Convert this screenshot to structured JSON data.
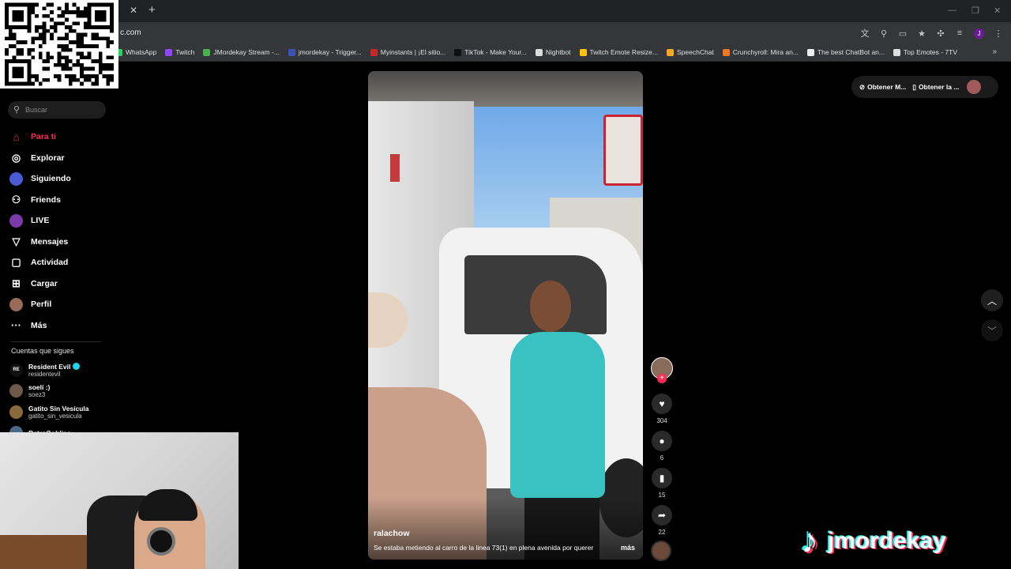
{
  "browser": {
    "url": "c.com",
    "tab_close": "✕",
    "tab_new": "+",
    "profile_initial": "J",
    "bookmarks": [
      {
        "label": "WhatsApp",
        "color": "#25d366"
      },
      {
        "label": "Twitch",
        "color": "#9146ff"
      },
      {
        "label": "JMordekay Stream -...",
        "color": "#4caf50"
      },
      {
        "label": "jmordekay - Trigger...",
        "color": "#3f51b5"
      },
      {
        "label": "Myinstants | ¡El sitio...",
        "color": "#c62828"
      },
      {
        "label": "TikTok - Make Your...",
        "color": "#111111"
      },
      {
        "label": "Nightbot",
        "color": "#dddddd"
      },
      {
        "label": "Twitch Emote Resize...",
        "color": "#ffc107"
      },
      {
        "label": "SpeechChat",
        "color": "#f9a825"
      },
      {
        "label": "Crunchyroll: Mira an...",
        "color": "#f47521"
      },
      {
        "label": "The best ChatBot an...",
        "color": "#eeeeee"
      },
      {
        "label": "Top Emotes - 7TV",
        "color": "#dddddd"
      }
    ]
  },
  "sidebar": {
    "search_placeholder": "Buscar",
    "nav": [
      {
        "label": "Para ti",
        "icon": "home-icon",
        "glyph": "⌂"
      },
      {
        "label": "Explorar",
        "icon": "compass-icon",
        "glyph": "◎"
      },
      {
        "label": "Siguiendo",
        "icon": "following-avatar",
        "glyph": ""
      },
      {
        "label": "Friends",
        "icon": "friends-icon",
        "glyph": "⚇"
      },
      {
        "label": "LIVE",
        "icon": "live-avatar",
        "glyph": ""
      },
      {
        "label": "Mensajes",
        "icon": "send-icon",
        "glyph": "▽"
      },
      {
        "label": "Actividad",
        "icon": "activity-icon",
        "glyph": "▢"
      },
      {
        "label": "Cargar",
        "icon": "upload-icon",
        "glyph": "⊞"
      },
      {
        "label": "Perfil",
        "icon": "profile-avatar",
        "glyph": ""
      },
      {
        "label": "Más",
        "icon": "more-icon",
        "glyph": "···"
      }
    ],
    "following_title": "Cuentas que sigues",
    "following": [
      {
        "name": "Resident Evil",
        "handle": "residentevil",
        "verified": true,
        "badge": "RE"
      },
      {
        "name": "soelí :)",
        "handle": "soez3",
        "verified": false,
        "badge": ""
      },
      {
        "name": "Gatito Sin Vesícula",
        "handle": "gatito_sin_vesicula",
        "verified": false,
        "badge": ""
      },
      {
        "name": "RetroGoblins",
        "handle": "",
        "verified": false,
        "badge": ""
      }
    ]
  },
  "video": {
    "username": "ralachow",
    "caption": "Se estaba metiendo al carro de la linea 73(1) en plena avenida por querer",
    "more": "más"
  },
  "actions": {
    "likes": "304",
    "comments": "6",
    "saves": "15",
    "shares": "22"
  },
  "top_right": {
    "btn1": "Obtener M...",
    "btn2": "Obtener la ..."
  },
  "brand": {
    "name": "jmordekay"
  },
  "colors": {
    "accent": "#fe2c55",
    "cyan": "#25f4ee"
  }
}
